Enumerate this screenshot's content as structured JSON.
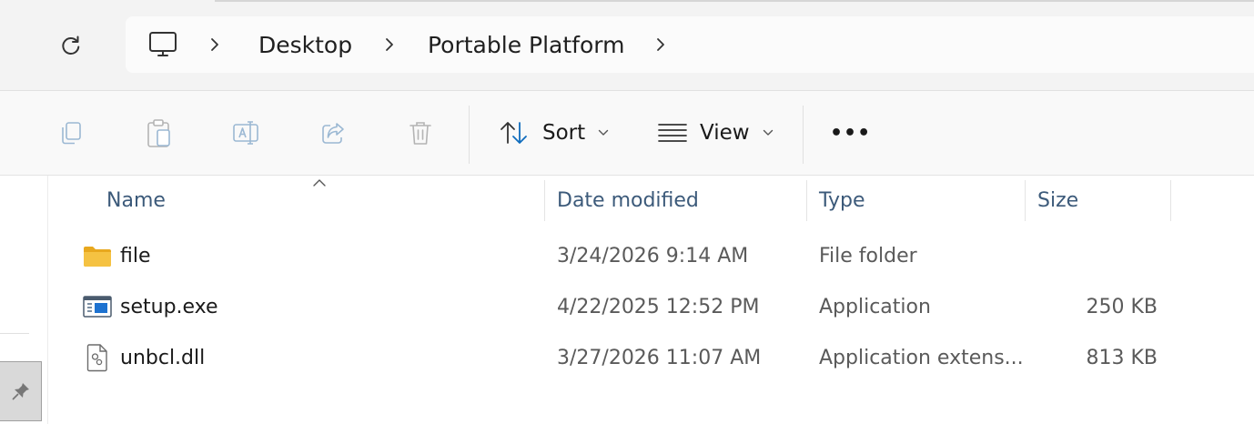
{
  "address_bar": {
    "breadcrumbs": [
      "Desktop",
      "Portable Platform"
    ],
    "root_icon": "this-pc-monitor-icon"
  },
  "command_bar": {
    "sort_label": "Sort",
    "view_label": "View",
    "more_label": "•••",
    "disabled_icons": [
      "copy-icon",
      "paste-icon",
      "rename-icon",
      "share-icon",
      "delete-icon"
    ]
  },
  "file_list": {
    "columns": [
      "Name",
      "Date modified",
      "Type",
      "Size"
    ],
    "sorted_by": "Name",
    "rows": [
      {
        "name": "file",
        "date": "3/24/2026 9:14 AM",
        "type": "File folder",
        "size": "",
        "icon": "folder-icon"
      },
      {
        "name": "setup.exe",
        "date": "4/22/2025 12:52 PM",
        "type": "Application",
        "size": "250 KB",
        "icon": "application-exe-icon"
      },
      {
        "name": "unbcl.dll",
        "date": "3/27/2026 11:07 AM",
        "type": "Application extens...",
        "size": "813 KB",
        "icon": "dll-file-icon"
      }
    ]
  },
  "colors": {
    "header_text": "#3c5a7a",
    "folder": "#f5c242",
    "disabled_icon": "#9bb8d3",
    "accent": "#0f6cbd"
  }
}
